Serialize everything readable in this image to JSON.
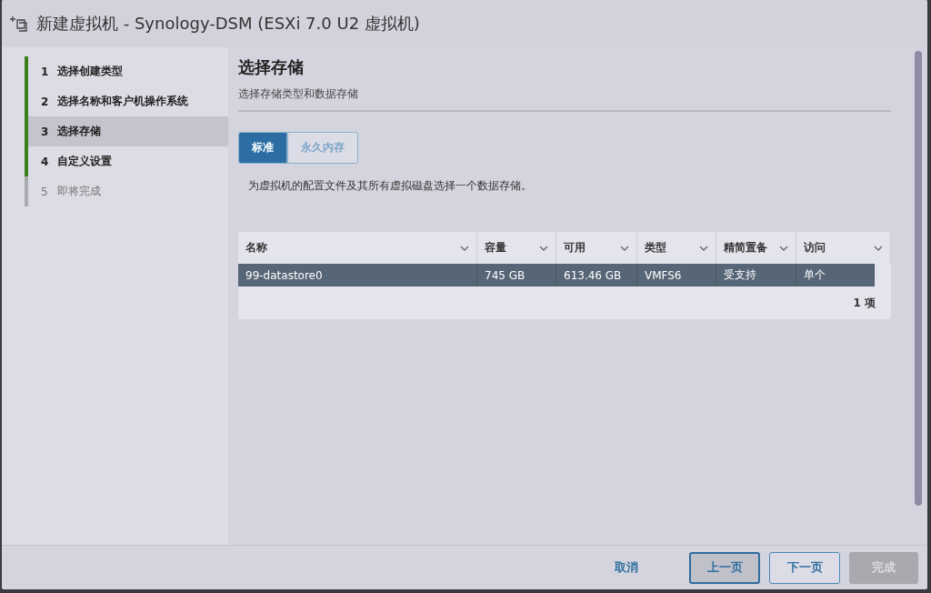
{
  "window": {
    "title": "新建虚拟机 - Synology-DSM (ESXi 7.0 U2 虚拟机)"
  },
  "steps": [
    {
      "number": "1",
      "label": "选择创建类型",
      "completed": true,
      "selected": false
    },
    {
      "number": "2",
      "label": "选择名称和客户机操作系统",
      "completed": true,
      "selected": false
    },
    {
      "number": "3",
      "label": "选择存储",
      "completed": true,
      "selected": true
    },
    {
      "number": "4",
      "label": "自定义设置",
      "completed": true,
      "selected": false
    },
    {
      "number": "5",
      "label": "即将完成",
      "completed": false,
      "selected": false
    }
  ],
  "page": {
    "title": "选择存储",
    "subtitle": "选择存储类型和数据存储"
  },
  "tabs": [
    {
      "label": "标准",
      "selected": true
    },
    {
      "label": "永久内存",
      "selected": false
    }
  ],
  "description": "为虚拟机的配置文件及其所有虚拟磁盘选择一个数据存储。",
  "table": {
    "columns": [
      "名称",
      "容量",
      "可用",
      "类型",
      "精简置备",
      "访问"
    ],
    "rows": [
      {
        "cells": [
          "99-datastore0",
          "745 GB",
          "613.46 GB",
          "VMFS6",
          "受支持",
          "单个"
        ],
        "selected": true
      }
    ],
    "footer": "1 项"
  },
  "buttons": [
    {
      "label": "取消",
      "kind": "link",
      "disabled": false
    },
    {
      "label": "上一页",
      "kind": "focused",
      "disabled": false
    },
    {
      "label": "下一页",
      "kind": "outline",
      "disabled": false
    },
    {
      "label": "完成",
      "kind": "solid",
      "disabled": true
    }
  ]
}
